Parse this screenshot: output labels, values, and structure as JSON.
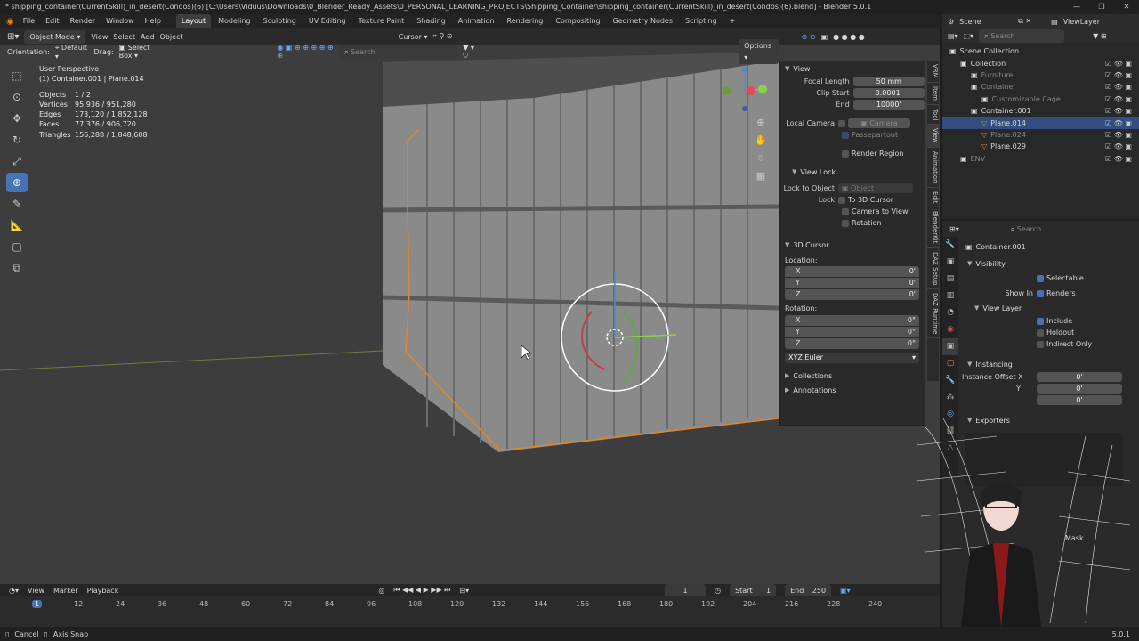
{
  "title": {
    "text": "* shipping_container(CurrentSkill)_in_desert(Condos)(6) [C:\\Users\\Viduus\\Downloads\\0_Blender_Ready_Assets\\0_PERSONAL_LEARNING_PROJECTS\\Shipping_Container\\shipping_container(CurrentSkill)_in_desert(Condos)(6).blend] - Blender 5.0.1"
  },
  "menu": [
    "File",
    "Edit",
    "Render",
    "Window",
    "Help"
  ],
  "workspaces": [
    "Layout",
    "Modeling",
    "Sculpting",
    "UV Editing",
    "Texture Paint",
    "Shading",
    "Animation",
    "Rendering",
    "Compositing",
    "Geometry Nodes",
    "Scripting"
  ],
  "workspace_add": "+",
  "viewport_header": {
    "mode": "Object Mode",
    "menus": [
      "View",
      "Select",
      "Add",
      "Object"
    ],
    "cursor": "Cursor",
    "search_placeholder": "Search",
    "options": "Options"
  },
  "tool_header": {
    "orientation_label": "Orientation:",
    "orientation": "Default",
    "drag_label": "Drag:",
    "drag": "Select Box"
  },
  "stats": {
    "view": "User Perspective",
    "active": "(1) Container.001 | Plane.014",
    "rows": [
      {
        "k": "Objects",
        "v": "1 / 2"
      },
      {
        "k": "Vertices",
        "v": "95,936 / 951,280"
      },
      {
        "k": "Edges",
        "v": "173,120 / 1,852,128"
      },
      {
        "k": "Faces",
        "v": "77,376 / 906,720"
      },
      {
        "k": "Triangles",
        "v": "156,288 / 1,848,608"
      }
    ]
  },
  "npanel": {
    "view": {
      "header": "View",
      "focal_length_label": "Focal Length",
      "focal_length": "50 mm",
      "clip_start_label": "Clip Start",
      "clip_start": "0.0001'",
      "end_label": "End",
      "end": "10000'",
      "local_camera_label": "Local Camera",
      "camera": "Camera",
      "passepartout": "Passepartout",
      "render_region": "Render Region"
    },
    "view_lock": {
      "header": "View Lock",
      "lock_to_object_label": "Lock to Object",
      "object_placeholder": "Object",
      "lock_label": "Lock",
      "to_3d_cursor": "To 3D Cursor",
      "camera_to_view": "Camera to View",
      "rotation": "Rotation"
    },
    "cursor": {
      "header": "3D Cursor",
      "location_label": "Location:",
      "rotation_label": "Rotation:",
      "loc": [
        {
          "a": "X",
          "v": "0'"
        },
        {
          "a": "Y",
          "v": "0'"
        },
        {
          "a": "Z",
          "v": "0'"
        }
      ],
      "rot": [
        {
          "a": "X",
          "v": "0°"
        },
        {
          "a": "Y",
          "v": "0°"
        },
        {
          "a": "Z",
          "v": "0°"
        }
      ],
      "mode": "XYZ Euler"
    },
    "collections": "Collections",
    "annotations": "Annotations"
  },
  "sidetabs": [
    "VRM",
    "Item",
    "Tool",
    "View",
    "Animation",
    "Edit",
    "BlenderKit",
    "DAZ Setup",
    "DAZ Runtime"
  ],
  "outliner": {
    "scene": "Scene",
    "view_layer": "ViewLayer",
    "search_placeholder": "Search",
    "rows": [
      {
        "name": "Scene Collection",
        "indent": 0,
        "sel": false,
        "dim": false,
        "icon": "collection-icon"
      },
      {
        "name": "Collection",
        "indent": 1,
        "sel": false,
        "dim": false,
        "icon": "collection-icon"
      },
      {
        "name": "Furniture",
        "indent": 2,
        "sel": false,
        "dim": true,
        "icon": "collection-icon"
      },
      {
        "name": "Container",
        "indent": 2,
        "sel": false,
        "dim": true,
        "icon": "collection-icon"
      },
      {
        "name": "Customizable Cage",
        "indent": 3,
        "sel": false,
        "dim": true,
        "icon": "collection-icon"
      },
      {
        "name": "Container.001",
        "indent": 2,
        "sel": false,
        "dim": false,
        "icon": "collection-icon"
      },
      {
        "name": "Plane.014",
        "indent": 3,
        "sel": true,
        "dim": false,
        "icon": "mesh-icon"
      },
      {
        "name": "Plane.024",
        "indent": 3,
        "sel": false,
        "dim": true,
        "icon": "mesh-icon"
      },
      {
        "name": "Plane.029",
        "indent": 3,
        "sel": false,
        "dim": false,
        "icon": "mesh-icon"
      },
      {
        "name": "ENV",
        "indent": 1,
        "sel": false,
        "dim": true,
        "icon": "collection-icon"
      }
    ]
  },
  "properties": {
    "search_placeholder": "Search",
    "object": "Container.001",
    "visibility": "Visibility",
    "selectable": "Selectable",
    "show_in": "Show In",
    "renders": "Renders",
    "view_layer": "View Layer",
    "include": "Include",
    "holdout": "Holdout",
    "indirect_only": "Indirect Only",
    "instancing": "Instancing",
    "instance_offset_x": "Instance Offset X",
    "y": "Y",
    "zero": "0'",
    "exporters": "Exporters",
    "mask": "Mask"
  },
  "timeline": {
    "menus": [
      "View",
      "Marker",
      "Playback"
    ],
    "frame": "1",
    "start_label": "Start",
    "start": "1",
    "end_label": "End",
    "end": "250",
    "ticks": [
      "1",
      "12",
      "24",
      "36",
      "48",
      "60",
      "72",
      "84",
      "96",
      "108",
      "120",
      "132",
      "144",
      "156",
      "168",
      "180",
      "192",
      "204",
      "216",
      "228",
      "240"
    ]
  },
  "status": {
    "cancel": "Cancel",
    "axis_snap": "Axis Snap",
    "version": "5.0.1"
  }
}
